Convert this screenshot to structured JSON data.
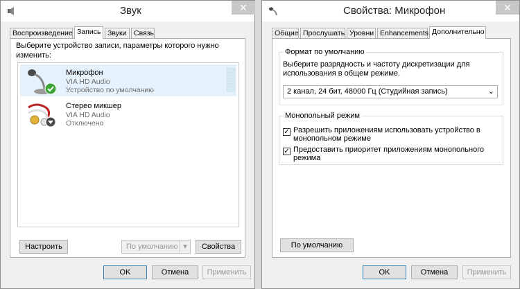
{
  "sound_dialog": {
    "title": "Звук",
    "close_glyph": "✕",
    "tabs": [
      {
        "label": "Воспроизведение",
        "active": false
      },
      {
        "label": "Запись",
        "active": true
      },
      {
        "label": "Звуки",
        "active": false
      },
      {
        "label": "Связь",
        "active": false
      }
    ],
    "instruction": "Выберите устройство записи, параметры которого нужно изменить:",
    "devices": [
      {
        "name": "Микрофон",
        "driver": "VIA HD Audio",
        "status": "Устройство по умолчанию",
        "icon": "microphone-icon",
        "badge": "default-checkmark-icon"
      },
      {
        "name": "Стерео микшер",
        "driver": "VIA HD Audio",
        "status": "Отключено",
        "icon": "stereo-mixer-icon",
        "badge": "disabled-arrow-icon"
      }
    ],
    "buttons": {
      "configure": "Настроить",
      "set_default": "По умолчанию",
      "properties": "Свойства",
      "ok": "OK",
      "cancel": "Отмена",
      "apply": "Применить"
    }
  },
  "props_dialog": {
    "title": "Свойства: Микрофон",
    "close_glyph": "✕",
    "tabs": [
      {
        "label": "Общие",
        "active": false
      },
      {
        "label": "Прослушать",
        "active": false
      },
      {
        "label": "Уровни",
        "active": false
      },
      {
        "label": "Enhancements",
        "active": false
      },
      {
        "label": "Дополнительно",
        "active": true
      }
    ],
    "default_format": {
      "legend": "Формат по умолчанию",
      "description": "Выберите разрядность и частоту дискретизации для использования в общем режиме.",
      "selected": "2 канал, 24 бит, 48000 Гц (Студийная запись)"
    },
    "exclusive_mode": {
      "legend": "Монопольный режим",
      "options": [
        {
          "label": "Разрешить приложениям использовать устройство в монопольном режиме",
          "checked": true
        },
        {
          "label": "Предоставить приоритет приложениям монопольного режима",
          "checked": true
        }
      ]
    },
    "buttons": {
      "restore_defaults": "По умолчанию",
      "ok": "OK",
      "cancel": "Отмена",
      "apply": "Применить"
    }
  },
  "colors": {
    "selection": "#e5f1fb",
    "check_green": "#3aa335",
    "level_meter": "#d9ecf4"
  }
}
